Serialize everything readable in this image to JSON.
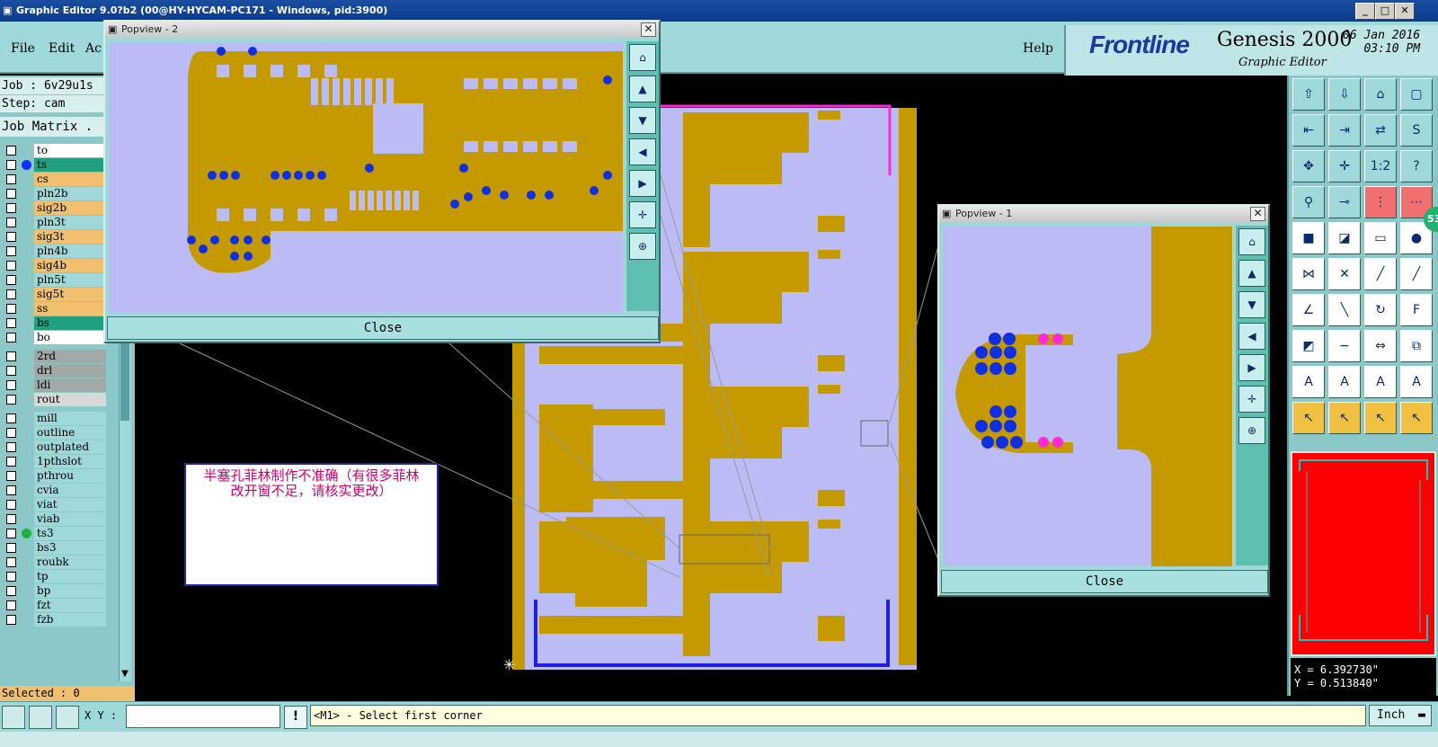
{
  "window": {
    "title": "Graphic Editor 9.0?b2 (00@HY-HYCAM-PC171 - Windows, pid:3900)"
  },
  "menu": {
    "file": "File",
    "edit": "Edit",
    "actions": "Ac",
    "help": "Help"
  },
  "brand": {
    "logo": "Frontline",
    "product": "Genesis 2000",
    "subtitle": "Graphic Editor",
    "date": "06 Jan 2016",
    "time": "03:10 PM"
  },
  "job": {
    "job_label": "Job : 6v29u1s",
    "step_label": "Step: cam",
    "matrix_label": "Job Matrix ."
  },
  "layers": [
    {
      "name": "to",
      "color": "#ffffff",
      "dot": ""
    },
    {
      "name": "ts",
      "color": "#20a080",
      "dot": "#1030ff"
    },
    {
      "name": "cs",
      "color": "#f0c070",
      "dot": ""
    },
    {
      "name": "pln2b",
      "color": "#9ed8d8",
      "dot": ""
    },
    {
      "name": "sig2b",
      "color": "#f0c070",
      "dot": ""
    },
    {
      "name": "pln3t",
      "color": "#9ed8d8",
      "dot": ""
    },
    {
      "name": "sig3t",
      "color": "#f0c070",
      "dot": ""
    },
    {
      "name": "pln4b",
      "color": "#9ed8d8",
      "dot": ""
    },
    {
      "name": "sig4b",
      "color": "#f0c070",
      "dot": ""
    },
    {
      "name": "pln5t",
      "color": "#9ed8d8",
      "dot": ""
    },
    {
      "name": "sig5t",
      "color": "#f0c070",
      "dot": ""
    },
    {
      "name": "ss",
      "color": "#f0c070",
      "dot": ""
    },
    {
      "name": "bs",
      "color": "#20a080",
      "dot": ""
    },
    {
      "name": "bo",
      "color": "#ffffff",
      "dot": ""
    },
    {
      "name": "2rd",
      "color": "#a0a8a8",
      "dot": ""
    },
    {
      "name": "drl",
      "color": "#a0a8a8",
      "dot": ""
    },
    {
      "name": "ldi",
      "color": "#a0a8a8",
      "dot": ""
    },
    {
      "name": "rout",
      "color": "#d8d8d8",
      "dot": ""
    },
    {
      "name": "mill",
      "color": "#9ed8d8",
      "dot": ""
    },
    {
      "name": "outline",
      "color": "#9ed8d8",
      "dot": ""
    },
    {
      "name": "outplated",
      "color": "#9ed8d8",
      "dot": ""
    },
    {
      "name": "1pthslot",
      "color": "#9ed8d8",
      "dot": ""
    },
    {
      "name": "pthrou",
      "color": "#9ed8d8",
      "dot": ""
    },
    {
      "name": "cvia",
      "color": "#9ed8d8",
      "dot": ""
    },
    {
      "name": "viat",
      "color": "#9ed8d8",
      "dot": ""
    },
    {
      "name": "viab",
      "color": "#9ed8d8",
      "dot": ""
    },
    {
      "name": "ts3",
      "color": "#9ed8d8",
      "dot": "#20b040"
    },
    {
      "name": "bs3",
      "color": "#9ed8d8",
      "dot": ""
    },
    {
      "name": "roubk",
      "color": "#9ed8d8",
      "dot": ""
    },
    {
      "name": "tp",
      "color": "#9ed8d8",
      "dot": ""
    },
    {
      "name": "bp",
      "color": "#9ed8d8",
      "dot": ""
    },
    {
      "name": "fzt",
      "color": "#9ed8d8",
      "dot": ""
    },
    {
      "name": "fzb",
      "color": "#9ed8d8",
      "dot": ""
    }
  ],
  "selected": "Selected : 0",
  "popview2": {
    "title": "Popview - 2",
    "close": "Close"
  },
  "popview1": {
    "title": "Popview - 1",
    "close": "Close"
  },
  "note": {
    "line1": "半塞孔菲林制作不准确（有很多菲林",
    "line2": "改开窗不足，请核实更改）"
  },
  "bottom": {
    "xy_label": "X Y :",
    "xy_value": "",
    "prompt": "<M1> - Select first corner",
    "units": "Inch"
  },
  "coords": {
    "x": "X = 6.392730\"",
    "y": "Y = 0.513840\""
  },
  "badge": "53",
  "colors": {
    "board": "#bcbcf4",
    "copper": "#c49a00",
    "pad": "#1030e0",
    "highlight": "#ff2ad4",
    "outline": "#2020e0"
  }
}
